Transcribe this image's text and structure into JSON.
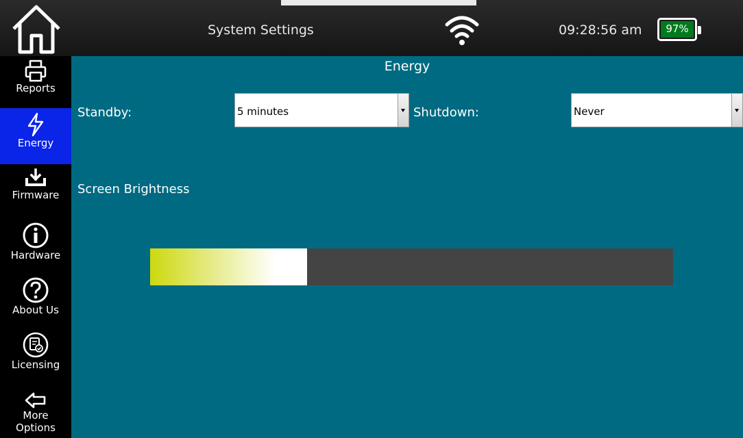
{
  "header": {
    "title": "System Settings",
    "time": "09:28:56 am",
    "battery": "97%",
    "home_icon": "home-icon",
    "wifi_icon": "wifi-icon"
  },
  "sidebar": {
    "items": [
      {
        "label": "Reports",
        "icon": "printer-icon",
        "active": false
      },
      {
        "label": "Energy",
        "icon": "lightning-icon",
        "active": true
      },
      {
        "label": "Firmware",
        "icon": "download-icon",
        "active": false
      },
      {
        "label": "Hardware",
        "icon": "info-icon",
        "active": false
      },
      {
        "label": "About Us",
        "icon": "question-icon",
        "active": false
      },
      {
        "label": "Licensing",
        "icon": "license-icon",
        "active": false
      },
      {
        "label": "More Options",
        "icon": "arrow-left-icon",
        "active": false
      }
    ]
  },
  "main": {
    "title": "Energy",
    "standby_label": "Standby:",
    "standby_value": "5 minutes",
    "shutdown_label": "Shutdown:",
    "shutdown_value": "Never",
    "brightness_label": "Screen Brightness",
    "brightness_level_fraction": 0.3
  },
  "colors": {
    "background": "#006a82",
    "active_nav": "#0a24e8",
    "battery_fill": "#007a1e",
    "slider_track": "#444444",
    "slider_fill_start": "#cdd90e"
  }
}
